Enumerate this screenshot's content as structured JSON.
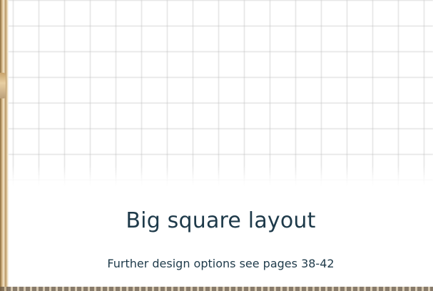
{
  "caption": {
    "title": "Big square layout",
    "subtitle": "Further design options see pages 38-42"
  }
}
